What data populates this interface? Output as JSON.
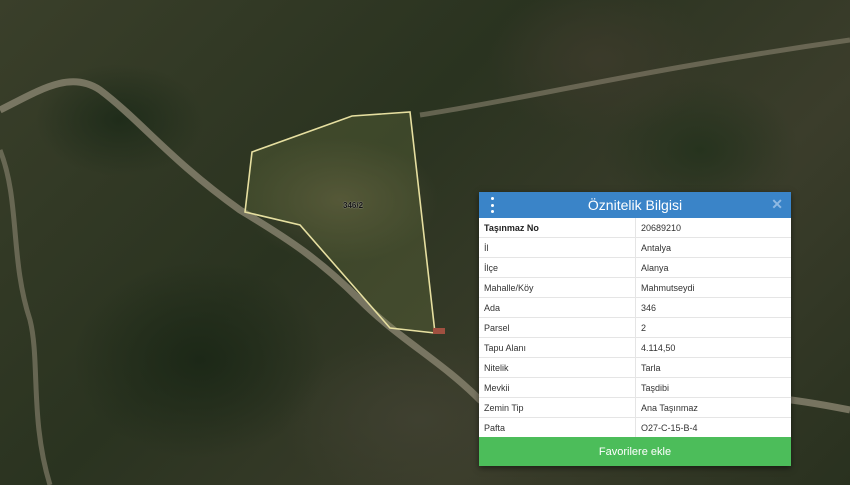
{
  "map": {
    "parcel_label": "346/2",
    "parcel_outline_color": "#e6dfa0"
  },
  "panel": {
    "title": "Öznitelik Bilgisi",
    "menu_icon": "vertical-dots-icon",
    "close_icon": "close-icon",
    "header_color": "#3a84c8",
    "rows": [
      {
        "key": "Taşınmaz No",
        "value": "20689210"
      },
      {
        "key": "İl",
        "value": "Antalya"
      },
      {
        "key": "İlçe",
        "value": "Alanya"
      },
      {
        "key": "Mahalle/Köy",
        "value": "Mahmutseydi"
      },
      {
        "key": "Ada",
        "value": "346"
      },
      {
        "key": "Parsel",
        "value": "2"
      },
      {
        "key": "Tapu Alanı",
        "value": "4.114,50"
      },
      {
        "key": "Nitelik",
        "value": "Tarla"
      },
      {
        "key": "Mevkii",
        "value": "Taşdibi"
      },
      {
        "key": "Zemin Tip",
        "value": "Ana Taşınmaz"
      },
      {
        "key": "Pafta",
        "value": "O27-C-15-B-4"
      }
    ],
    "favorite_button_label": "Favorilere ekle",
    "favorite_button_color": "#4cbd5a"
  }
}
